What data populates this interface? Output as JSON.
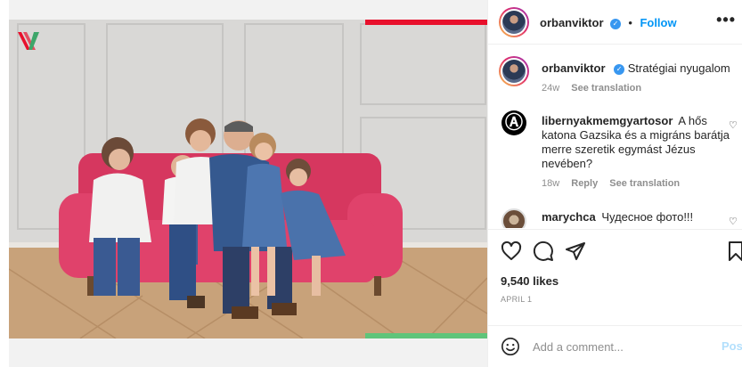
{
  "post": {
    "author": "orbanviktor",
    "follow_label": "Follow",
    "separator": "•",
    "more_label": "•••",
    "verified_mark": "✓"
  },
  "caption": {
    "username": "orbanviktor",
    "text": "Stratégiai nyugalom",
    "age": "24w",
    "see_translation": "See translation"
  },
  "comments": [
    {
      "username": "libernyakmemgyartosor",
      "text": "A hős katona Gazsika és a migráns barátja merre szeretik egymást Jézus nevében?",
      "age": "18w",
      "reply_label": "Reply",
      "see_translation": "See translation",
      "avatar_glyph": "Ⓐ"
    },
    {
      "username": "marychca",
      "text": "Чудесное фото!!!"
    }
  ],
  "engagement": {
    "likes": "9,540 likes",
    "date": "APRIL 1"
  },
  "comment_box": {
    "placeholder": "Add a comment...",
    "post_label": "Post"
  },
  "icons": {
    "like": "heart-icon",
    "comment": "comment-icon",
    "share": "share-icon",
    "save": "bookmark-icon",
    "emoji": "emoji-icon",
    "more": "more-options-icon"
  },
  "colors": {
    "accent": "#0095f6",
    "sofa": "#e0426b",
    "brand_red": "#e8102c",
    "brand_green": "#5fc47a"
  }
}
